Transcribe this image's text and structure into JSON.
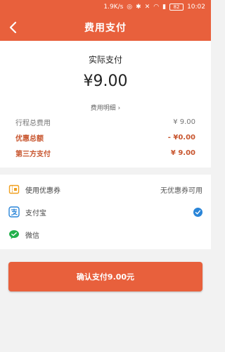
{
  "status_bar": {
    "speed": "1.9K/s",
    "battery": "82",
    "time": "10:02"
  },
  "header": {
    "title": "费用支付"
  },
  "summary": {
    "pay_label": "实际支付",
    "pay_amount": "¥9.00",
    "detail_link": "费用明细 ›",
    "rows": [
      {
        "label": "行程总费用",
        "value": "¥ 9.00"
      },
      {
        "label": "优惠总额",
        "value": "- ¥0.00"
      },
      {
        "label": "第三方支付",
        "value": "¥ 9.00"
      }
    ]
  },
  "options": {
    "coupon": {
      "label": "使用优惠券",
      "value": "无优惠券可用"
    },
    "alipay": {
      "label": "支付宝",
      "selected": true
    },
    "wechat": {
      "label": "微信"
    }
  },
  "confirm": {
    "label": "确认支付9.00元"
  },
  "colors": {
    "accent": "#e8603c",
    "red_text": "#c8552e",
    "alipay_blue": "#2a85d8",
    "wechat_green": "#22b14c",
    "coupon_orange": "#f0a020"
  }
}
